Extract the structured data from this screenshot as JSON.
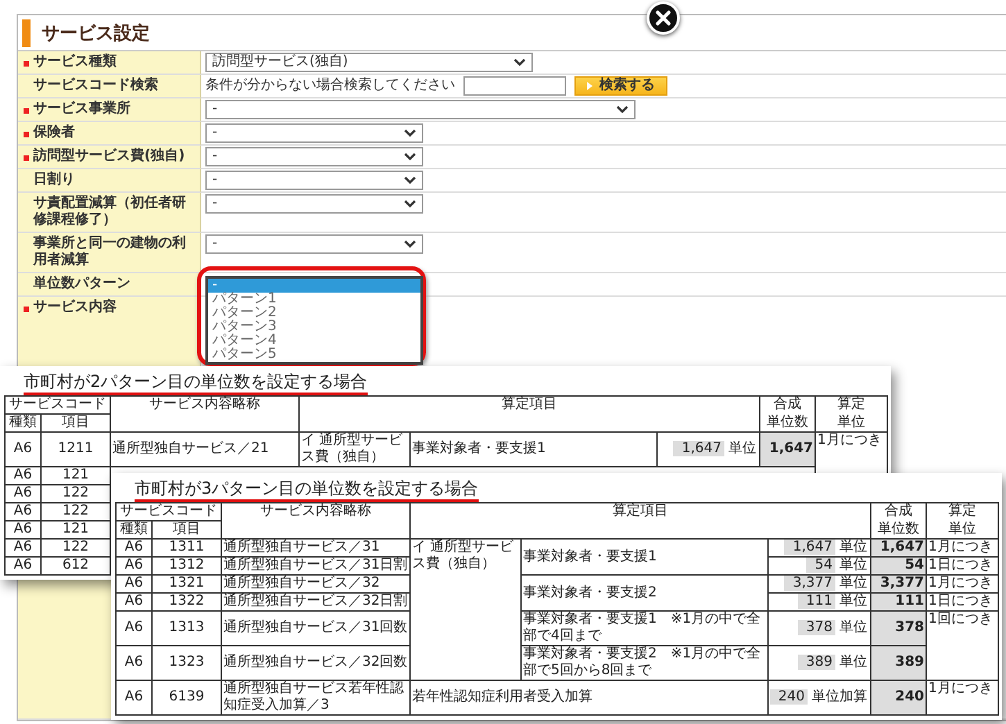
{
  "dialog": {
    "title": "サービス設定"
  },
  "form": {
    "rows": [
      {
        "label": "サービス種類",
        "required": true,
        "kind": "select",
        "value": "訪問型サービス(独自)"
      },
      {
        "label": "サービスコード検索",
        "required": false,
        "kind": "search",
        "hint": "条件が分からない場合検索してください",
        "button": "検索する"
      },
      {
        "label": "サービス事業所",
        "required": true,
        "kind": "select",
        "value": "-"
      },
      {
        "label": "保険者",
        "required": true,
        "kind": "select",
        "value": "-"
      },
      {
        "label": "訪問型サービス費(独自)",
        "required": true,
        "kind": "select",
        "value": "-"
      },
      {
        "label": "日割り",
        "required": false,
        "kind": "select",
        "value": "-"
      },
      {
        "label": "サ責配置減算（初任者研修課程修了）",
        "required": false,
        "kind": "select",
        "value": "-"
      },
      {
        "label": "事業所と同一の建物の利用者減算",
        "required": false,
        "kind": "select",
        "value": "-"
      },
      {
        "label": "単位数パターン",
        "required": false,
        "kind": "listbox",
        "highlighted": true,
        "options": [
          {
            "label": "-",
            "selected": true
          },
          {
            "label": "パターン1",
            "selected": false
          },
          {
            "label": "パターン2",
            "selected": false
          },
          {
            "label": "パターン3",
            "selected": false
          },
          {
            "label": "パターン4",
            "selected": false
          },
          {
            "label": "パターン5",
            "selected": false
          }
        ]
      },
      {
        "label": "サービス内容",
        "required": true,
        "kind": "empty"
      }
    ]
  },
  "documents": [
    {
      "title": "市町村が2パターン目の単位数を設定する場合",
      "header": {
        "code": "サービスコード",
        "type": "種類",
        "item": "項目",
        "name": "サービス内容略称",
        "calc": "算定項目",
        "total_top": "合成",
        "total_bottom": "単位数",
        "per_top": "算定",
        "per_bottom": "単位"
      },
      "rows": [
        {
          "type": "A6",
          "item": "1211",
          "name": "通所型独自サービス／21",
          "category": "イ 通所型サービス費（独自）",
          "condition": "事業対象者・要支援1",
          "units": "1,647",
          "unit_label": "単位",
          "total": "1,647",
          "per": "1月につき"
        },
        {
          "kind": "partial",
          "type": "A6",
          "item": "121"
        },
        {
          "kind": "partial",
          "type": "A6",
          "item": "122"
        },
        {
          "kind": "partial",
          "type": "A6",
          "item": "122"
        },
        {
          "kind": "partial",
          "type": "A6",
          "item": "121"
        },
        {
          "kind": "partial",
          "type": "A6",
          "item": "122"
        },
        {
          "kind": "partial",
          "type": "A6",
          "item": "612"
        }
      ]
    },
    {
      "title": "市町村が3パターン目の単位数を設定する場合",
      "header": {
        "code": "サービスコード",
        "type": "種類",
        "item": "項目",
        "name": "サービス内容略称",
        "calc": "算定項目",
        "total_top": "合成",
        "total_bottom": "単位数",
        "per_top": "算定",
        "per_bottom": "単位"
      },
      "rows": [
        {
          "type": "A6",
          "item": "1311",
          "name": "通所型独自サービス／31",
          "category": "イ 通所型サービス費（独自）",
          "condition": "事業対象者・要支援1",
          "units": "1,647",
          "unit_label": "単位",
          "total": "1,647",
          "per": "1月につき"
        },
        {
          "type": "A6",
          "item": "1312",
          "name": "通所型独自サービス／31日割",
          "units": "54",
          "unit_label": "単位",
          "total": "54",
          "per": "1日につき"
        },
        {
          "type": "A6",
          "item": "1321",
          "name": "通所型独自サービス／32",
          "condition": "事業対象者・要支援2",
          "units": "3,377",
          "unit_label": "単位",
          "total": "3,377",
          "per": "1月につき"
        },
        {
          "type": "A6",
          "item": "1322",
          "name": "通所型独自サービス／32日割",
          "units": "111",
          "unit_label": "単位",
          "total": "111",
          "per": "1日につき"
        },
        {
          "type": "A6",
          "item": "1313",
          "name": "通所型独自サービス／31回数",
          "condition": "事業対象者・要支援1　※1月の中で全部で4回まで",
          "units": "378",
          "unit_label": "単位",
          "total": "378",
          "per": "1回につき"
        },
        {
          "type": "A6",
          "item": "1323",
          "name": "通所型独自サービス／32回数",
          "condition": "事業対象者・要支援2　※1月の中で全部で5回から8回まで",
          "units": "389",
          "unit_label": "単位",
          "total": "389"
        },
        {
          "kind": "addition",
          "type": "A6",
          "item": "6139",
          "name": "通所型独自サービス若年性認知症受入加算／3",
          "label": "若年性認知症利用者受入加算",
          "units": "240",
          "unit_label": "単位加算",
          "total": "240",
          "per": "1月につき"
        }
      ]
    }
  ]
}
